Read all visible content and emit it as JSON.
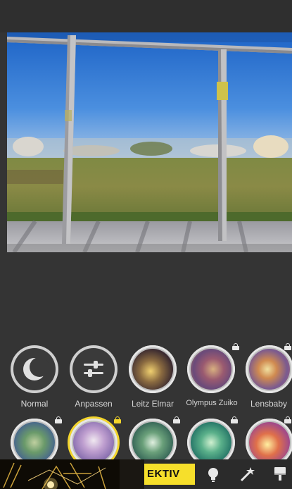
{
  "lenses_row1": [
    {
      "label": "Normal",
      "icon": "moon-icon",
      "locked": false
    },
    {
      "label": "Anpassen",
      "icon": "sliders-icon",
      "locked": false
    },
    {
      "label": "Leitz Elmar",
      "icon": "lens-preview",
      "locked": false
    },
    {
      "label": "Olympus Zuiko",
      "icon": "lens-preview",
      "locked": true
    },
    {
      "label": "Lensbaby",
      "icon": "lens-preview",
      "locked": true
    }
  ],
  "lenses_row2_locked": [
    true,
    true,
    false,
    true,
    true
  ],
  "bottom_bar": {
    "active_tab_label": "EKTIV",
    "tools": [
      "lightbulb-icon",
      "magic-wand-icon",
      "brush-icon"
    ]
  },
  "colors": {
    "accent": "#f6df2b",
    "background": "#343434"
  }
}
